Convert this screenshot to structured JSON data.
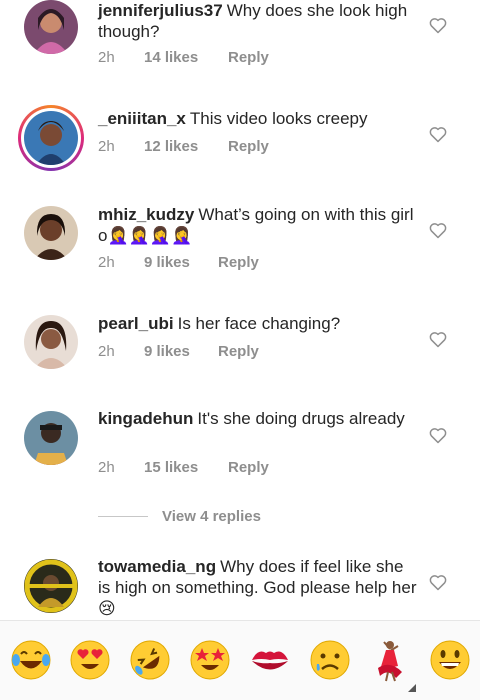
{
  "comments": [
    {
      "username": "jenniferjulius37",
      "text": "Why does she look high though?",
      "time": "2h",
      "likes": "14 likes",
      "reply": "Reply"
    },
    {
      "username": "_eniiitan_x",
      "text": "This video looks creepy",
      "time": "2h",
      "likes": "12 likes",
      "reply": "Reply"
    },
    {
      "username": "mhiz_kudzy",
      "text": "What’s going on with this girl o",
      "emojis": "🤦‍♀️🤦‍♀️🤦‍♀️🤦‍♀️",
      "time": "2h",
      "likes": "9 likes",
      "reply": "Reply"
    },
    {
      "username": "pearl_ubi",
      "text": "Is her face changing?",
      "time": "2h",
      "likes": "9 likes",
      "reply": "Reply"
    },
    {
      "username": "kingadehun",
      "text": "It's she doing drugs already",
      "time": "2h",
      "likes": "15 likes",
      "reply": "Reply"
    },
    {
      "username": "towamedia_ng",
      "text": "Why does if feel like she is high on something. God please help her",
      "emojis": "😢"
    }
  ],
  "view_replies": "View 4 replies",
  "emoji_bar": {
    "items": [
      "😂",
      "😍",
      "🤣",
      "🤩",
      "💋",
      "😥",
      "💃",
      "😃"
    ]
  },
  "icons": {
    "heart": "heart-outline-icon"
  },
  "colors": {
    "text": "#262626",
    "meta": "#8e8e8e",
    "story_ring": "#dd2a7b"
  }
}
